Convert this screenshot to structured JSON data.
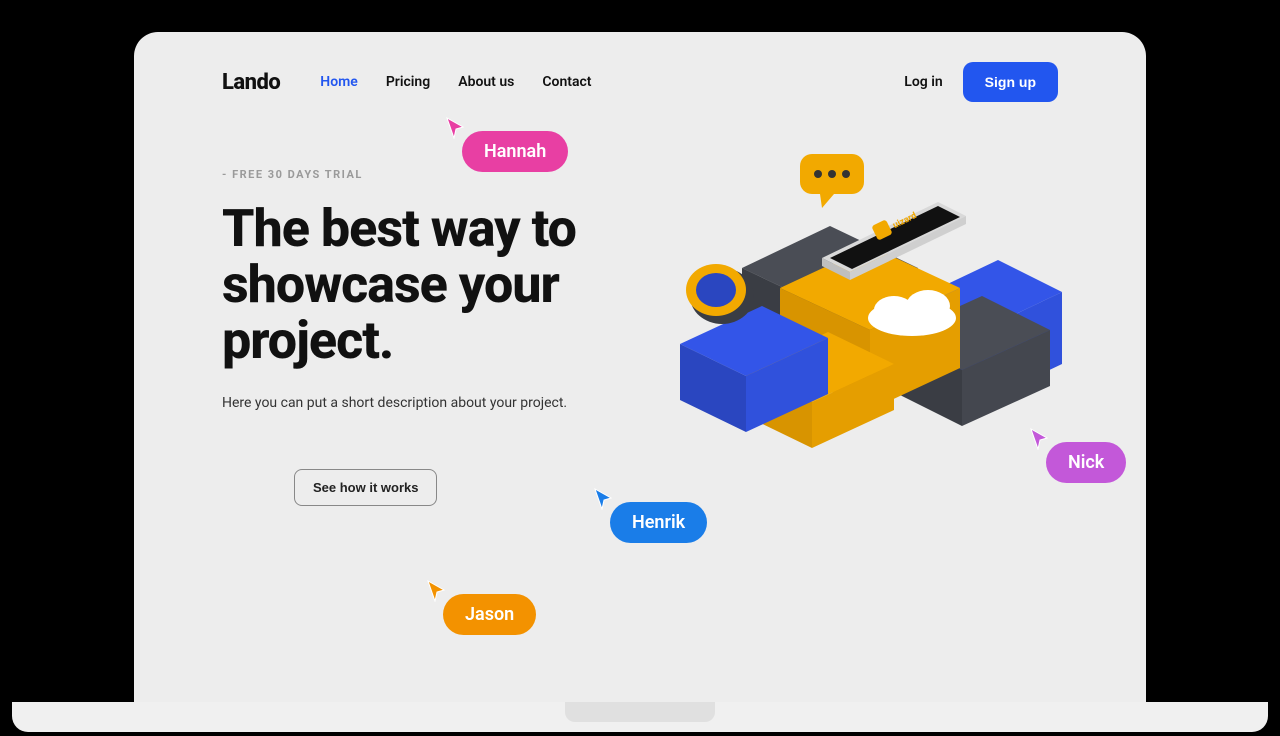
{
  "brand": {
    "name": "Lando"
  },
  "nav": {
    "items": [
      {
        "label": "Home",
        "active": true
      },
      {
        "label": "Pricing",
        "active": false
      },
      {
        "label": "About us",
        "active": false
      },
      {
        "label": "Contact",
        "active": false
      }
    ]
  },
  "auth": {
    "login_label": "Log in",
    "signup_label": "Sign up"
  },
  "hero": {
    "eyebrow": "- FREE 30 DAYS TRIAL",
    "title": "The best way to showcase your project.",
    "subtitle": "Here you can put a short description about your project.",
    "cta_label": "See how it works",
    "illustration": {
      "phone_app_label": "uizard"
    }
  },
  "collaborators": [
    {
      "name": "Hannah",
      "color": "#e83fa3"
    },
    {
      "name": "Henrik",
      "color": "#1a7de8"
    },
    {
      "name": "Jason",
      "color": "#f39200"
    },
    {
      "name": "Nick",
      "color": "#c358d9"
    }
  ]
}
